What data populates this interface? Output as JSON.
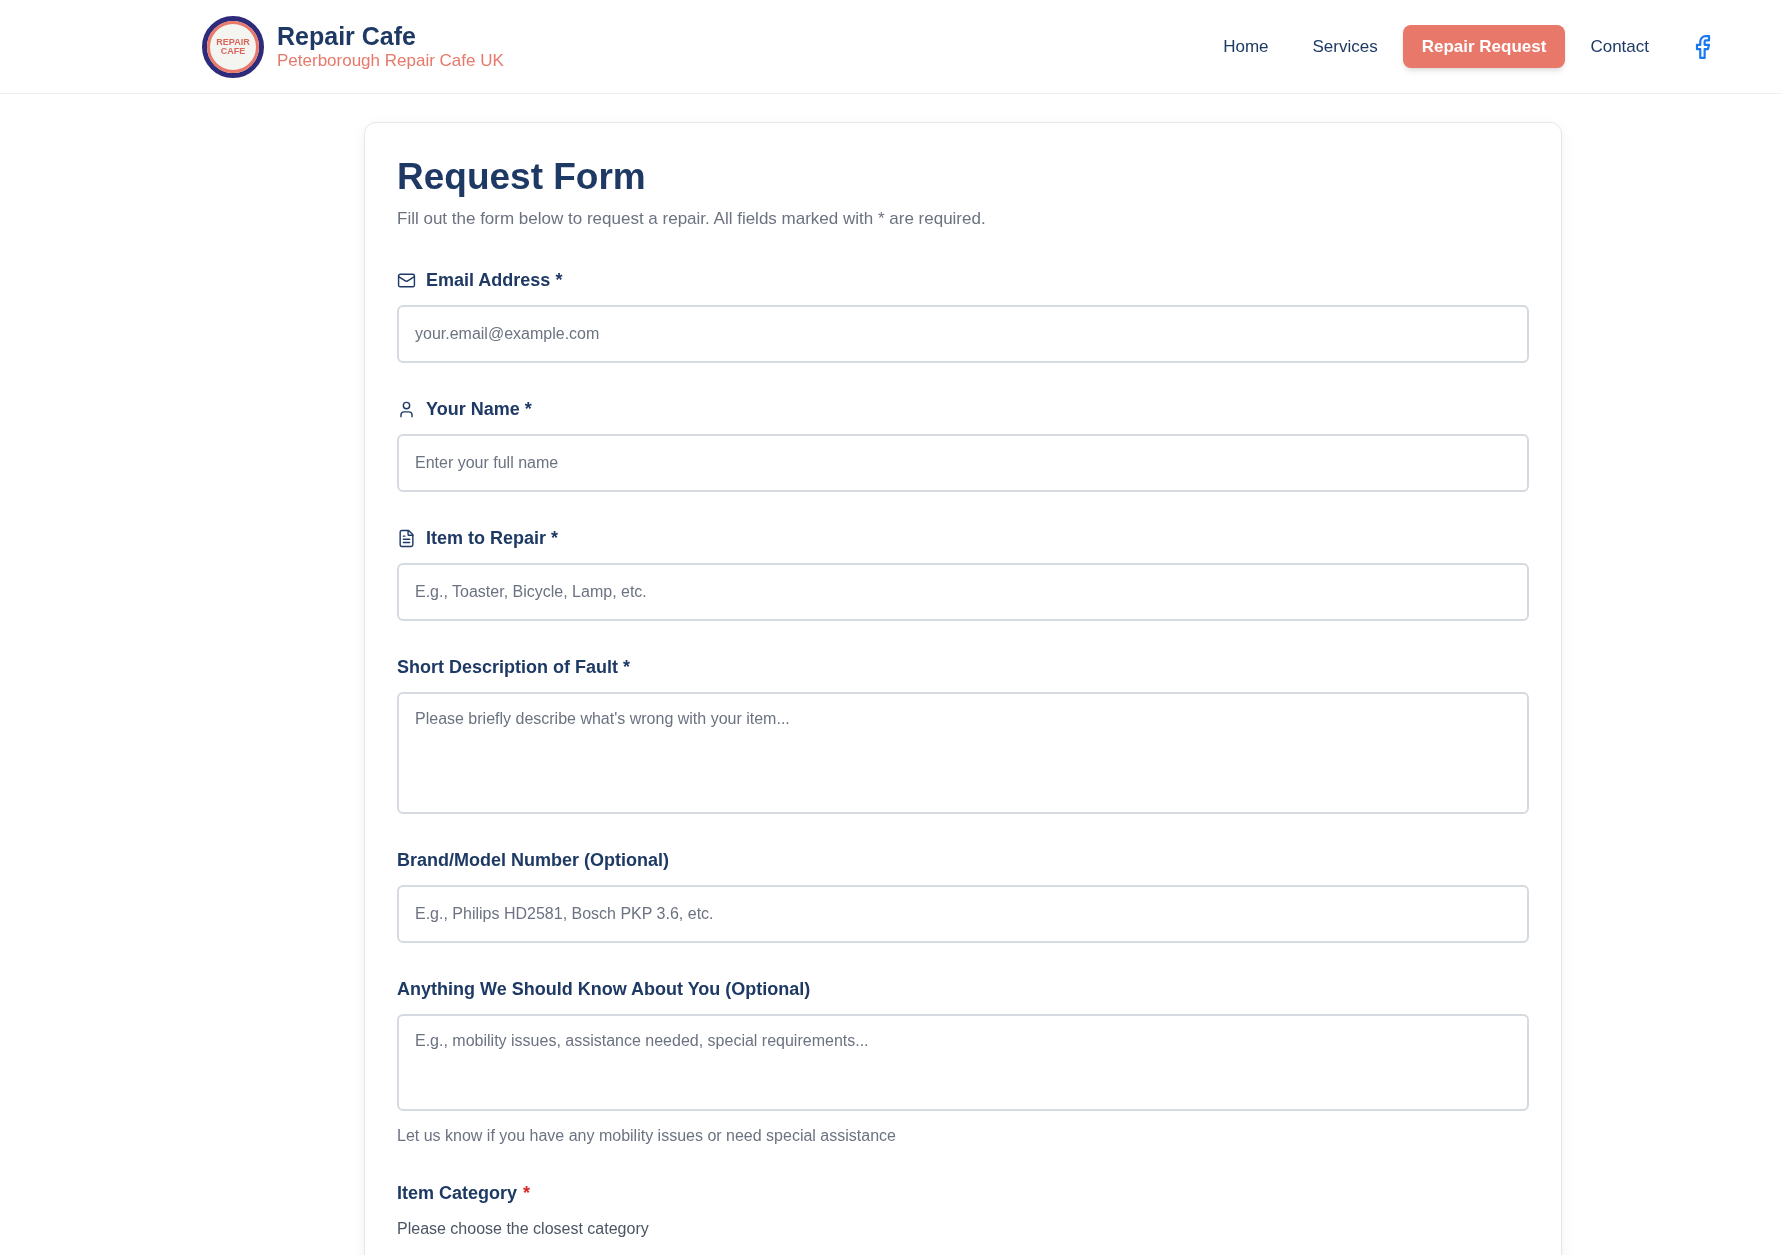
{
  "header": {
    "logo_text": "REPAIR CAFE",
    "site_title": "Repair Cafe",
    "tagline": "Peterborough Repair Cafe UK",
    "nav": [
      {
        "label": "Home",
        "selected": false
      },
      {
        "label": "Services",
        "selected": false
      },
      {
        "label": "Repair Request",
        "selected": true
      },
      {
        "label": "Contact",
        "selected": false
      }
    ]
  },
  "form": {
    "title": "Request Form",
    "intro": "Fill out the form below to request a repair. All fields marked with * are required.",
    "fields": [
      {
        "kind": "email",
        "label": "Email Address *",
        "placeholder": "your.email@example.com"
      },
      {
        "kind": "name",
        "label": "Your Name *",
        "placeholder": "Enter your full name"
      },
      {
        "kind": "item",
        "label": "Item to Repair *",
        "placeholder": "E.g., Toaster, Bicycle, Lamp, etc."
      },
      {
        "kind": "textarea",
        "label": "Short Description of Fault *",
        "placeholder": "Please briefly describe what's wrong with your item..."
      },
      {
        "kind": "text",
        "label": "Brand/Model Number (Optional)",
        "placeholder": "E.g., Philips HD2581, Bosch PKP 3.6, etc."
      },
      {
        "kind": "notes",
        "label": "Anything We Should Know About You (Optional)",
        "placeholder": "E.g., mobility issues, assistance needed, special requirements...",
        "hint": "Let us know if you have any mobility issues or need special assistance"
      },
      {
        "kind": "choice",
        "label": "Item Category",
        "required_mark": "*",
        "hint": "Please choose the closest category"
      }
    ]
  }
}
